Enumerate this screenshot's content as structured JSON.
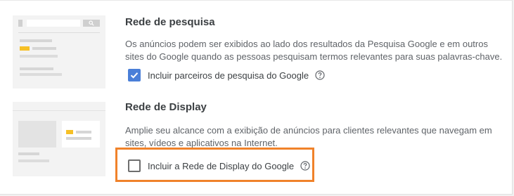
{
  "search_network": {
    "title": "Rede de pesquisa",
    "description_line1": "Os anúncios podem ser exibidos ao lado dos resultados da Pesquisa Google e em outros",
    "description_line2": "sites do Google quando as pessoas pesquisam termos relevantes para suas palavras-chave.",
    "checkbox_label": "Incluir parceiros de pesquisa do Google",
    "checked": true
  },
  "display_network": {
    "title": "Rede de Display",
    "description_line1": "Amplie seu alcance com a exibição de anúncios para clientes relevantes que navegam em",
    "description_line2": "sites, vídeos e aplicativos na Internet.",
    "checkbox_label": "Incluir a Rede de Display do Google",
    "checked": false
  },
  "colors": {
    "checkbox_checked": "#4a7fd8",
    "highlight": "#f0822a",
    "ad_accent": "#f6c026"
  },
  "icons": [
    "search-icon",
    "help-circle-icon",
    "checkmark-icon"
  ]
}
